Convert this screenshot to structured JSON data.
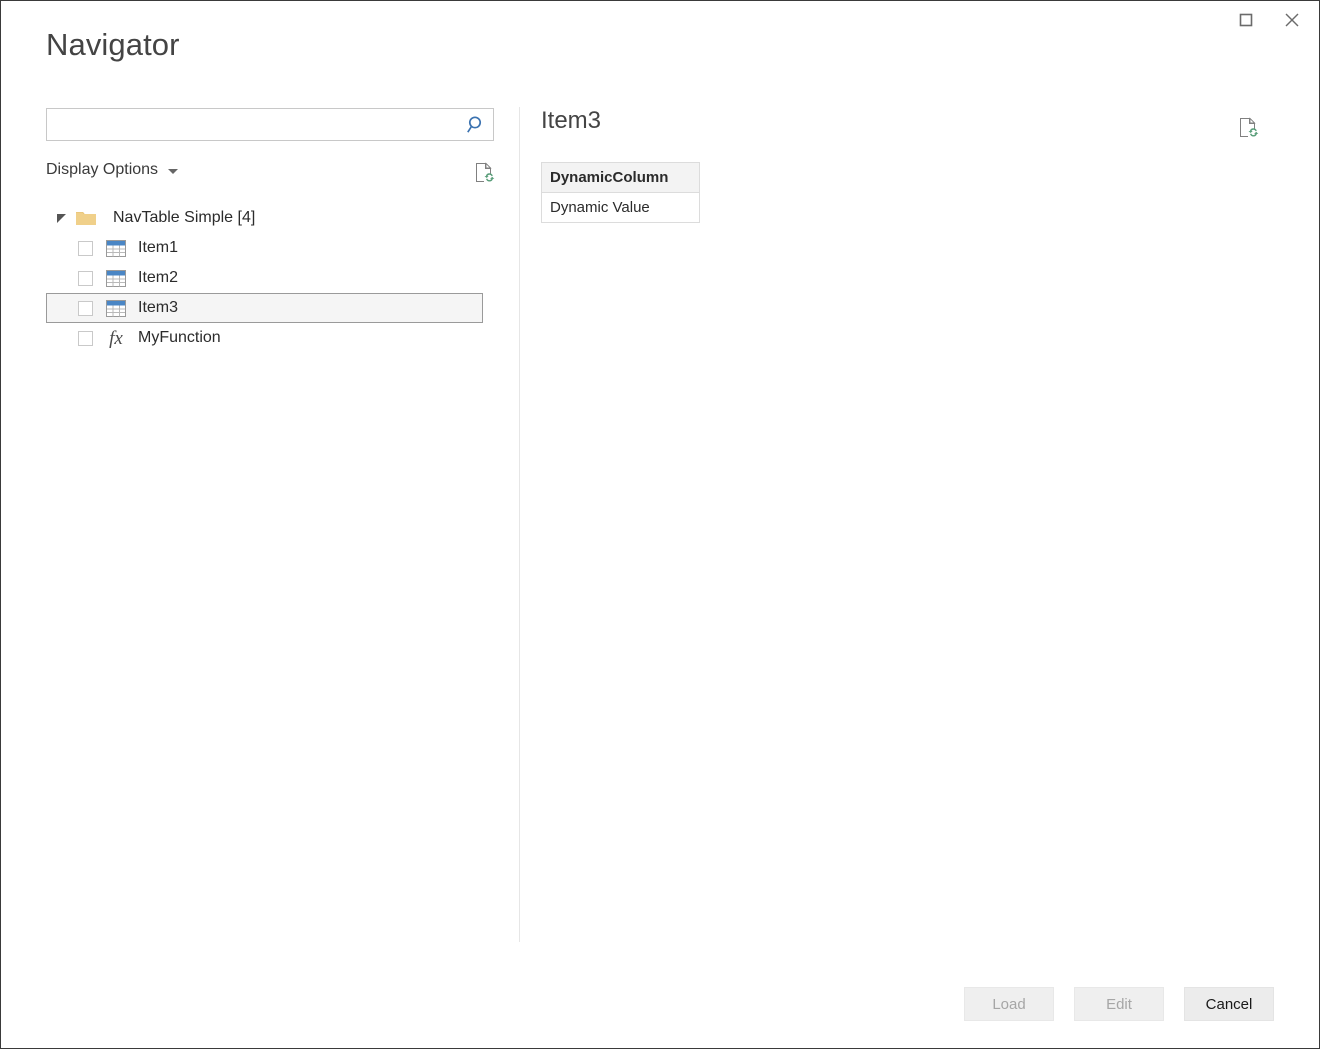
{
  "window": {
    "title": "Navigator",
    "controls": [
      {
        "name": "restore-button",
        "glyph": "restore"
      },
      {
        "name": "close-button",
        "glyph": "close"
      }
    ]
  },
  "search": {
    "value": "",
    "placeholder": "",
    "icon": "search-icon"
  },
  "display_options": {
    "label": "Display Options",
    "caret_icon": "chevron-down-icon",
    "refresh_icon": "document-refresh-icon"
  },
  "tree": {
    "root": {
      "label": "NavTable Simple [4]",
      "expanded": true,
      "expander_icon": "triangle-expanded-icon",
      "folder_icon": "folder-icon"
    },
    "items": [
      {
        "label": "Item1",
        "icon": "table-icon",
        "checked": false,
        "selected": false
      },
      {
        "label": "Item2",
        "icon": "table-icon",
        "checked": false,
        "selected": false
      },
      {
        "label": "Item3",
        "icon": "table-icon",
        "checked": false,
        "selected": true
      },
      {
        "label": "MyFunction",
        "icon": "function-fx-icon",
        "checked": false,
        "selected": false
      }
    ]
  },
  "preview": {
    "title": "Item3",
    "refresh_icon": "document-refresh-icon",
    "table": {
      "columns": [
        "DynamicColumn"
      ],
      "rows": [
        [
          "Dynamic Value"
        ]
      ]
    }
  },
  "footer": {
    "buttons": [
      {
        "label": "Load",
        "disabled": true
      },
      {
        "label": "Edit",
        "disabled": true
      },
      {
        "label": "Cancel",
        "disabled": false
      }
    ]
  },
  "colors": {
    "accent_blue": "#3b72b0",
    "folder": "#f0d08a",
    "selected_row_bg": "#f5f5f5",
    "table_header_bg": "#f3f3f3",
    "refresh_green": "#5a9e7a"
  }
}
